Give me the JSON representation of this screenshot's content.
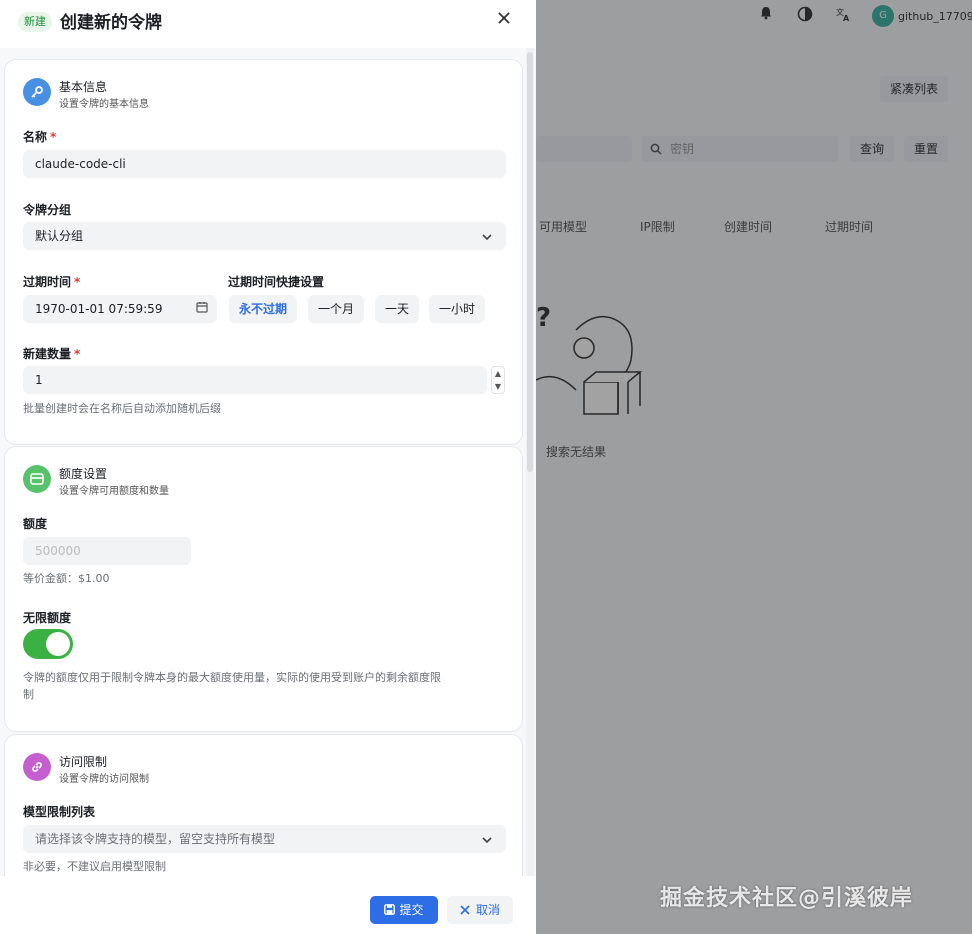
{
  "background": {
    "user_name": "github_17709",
    "avatar_initial": "G",
    "compact_list": "紧凑列表",
    "search_key_placeholder": "密钥",
    "query": "查询",
    "reset": "重置",
    "columns": [
      "可用模型",
      "IP限制",
      "创建时间",
      "过期时间"
    ],
    "empty_text": "搜索无结果"
  },
  "watermark": "掘金技术社区@引溪彼岸",
  "drawer": {
    "tag": "新建",
    "title": "创建新的令牌",
    "basic": {
      "title": "基本信息",
      "subtitle": "设置令牌的基本信息",
      "name_label": "名称",
      "name_value": "claude-code-cli",
      "group_label": "令牌分组",
      "group_value": "默认分组",
      "expire_label": "过期时间",
      "expire_value": "1970-01-01 07:59:59",
      "quick_label": "过期时间快捷设置",
      "quick_options": [
        "永不过期",
        "一个月",
        "一天",
        "一小时"
      ],
      "count_label": "新建数量",
      "count_value": "1",
      "count_hint": "批量创建时会在名称后自动添加随机后缀"
    },
    "quota": {
      "title": "额度设置",
      "subtitle": "设置令牌可用额度和数量",
      "quota_label": "额度",
      "quota_value": "500000",
      "equivalent": "等价金额：$1.00",
      "unlimited_label": "无限额度",
      "unlimited_on": true,
      "note_line1": "令牌的额度仅用于限制令牌本身的最大额度使用量，实际的使用受到账户的剩余额度限",
      "note_line2": "制"
    },
    "access": {
      "title": "访问限制",
      "subtitle": "设置令牌的访问限制",
      "models_label": "模型限制列表",
      "models_placeholder": "请选择该令牌支持的模型，留空支持所有模型",
      "models_hint": "非必要，不建议启用模型限制"
    },
    "submit": "提交",
    "cancel": "取消"
  },
  "colors": {
    "primary": "#2d6de6",
    "toggle_on": "#3bb143",
    "basic_icon": "#4a90e2",
    "quota_icon": "#58c26b",
    "access_icon": "#c55ecf",
    "required": "#e53935"
  }
}
